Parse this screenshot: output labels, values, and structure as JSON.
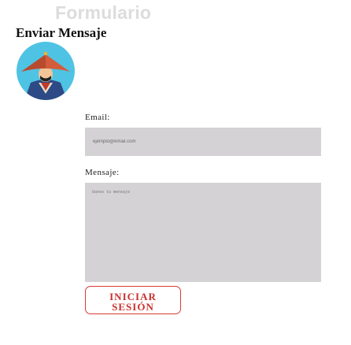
{
  "header": {
    "page_title": "Formulario",
    "form_heading": "Enviar Mensaje"
  },
  "avatar": {
    "icon": "samurai-avatar-icon"
  },
  "form": {
    "email": {
      "label": "Email:",
      "placeholder": "ejemplo@email.com",
      "value": ""
    },
    "message": {
      "label": "Mensaje:",
      "placeholder": "Danos tu mensaje",
      "value": ""
    },
    "submit": {
      "line1": "INICIAR",
      "line2": "SESIÓN"
    }
  },
  "colors": {
    "title_gray": "#dcdcdc",
    "field_bg": "#d4d2d4",
    "button_red": "#d63a36",
    "avatar_bg": "#4fc3e3"
  }
}
